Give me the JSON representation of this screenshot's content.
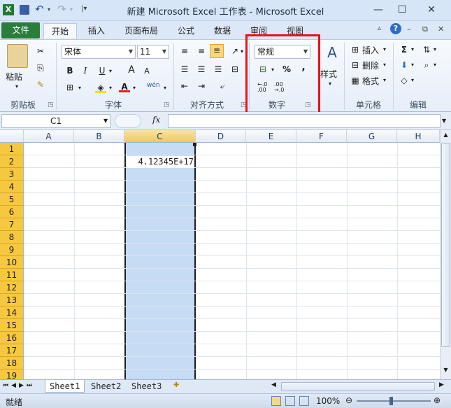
{
  "window": {
    "title": "新建 Microsoft Excel 工作表 - Microsoft Excel",
    "quick_access": [
      "save-icon",
      "undo-icon",
      "redo-icon",
      "customize-icon"
    ]
  },
  "tabs": [
    "文件",
    "开始",
    "插入",
    "页面布局",
    "公式",
    "数据",
    "审阅",
    "视图"
  ],
  "active_tab": "开始",
  "ribbon": {
    "clipboard": {
      "paste_label": "粘贴",
      "group_label": "剪贴板"
    },
    "font": {
      "font_name": "宋体",
      "font_size": "11",
      "group_label": "字体",
      "bold": "B",
      "italic": "I",
      "underline": "U",
      "grow": "A",
      "shrink": "A",
      "wen": "wén"
    },
    "alignment": {
      "group_label": "对齐方式"
    },
    "number": {
      "format": "常规",
      "percent": "%",
      "comma": ",",
      "group_label": "数字",
      "inc_decimal": "+.0 .00",
      "dec_decimal": ".00 ->.0"
    },
    "styles": {
      "label": "样式"
    },
    "cells": {
      "insert": "插入",
      "delete": "删除",
      "format": "格式",
      "group_label": "单元格"
    },
    "editing": {
      "group_label": "编辑",
      "sigma": "Σ"
    }
  },
  "formula_bar": {
    "name_box": "C1",
    "fx": "fx",
    "value": ""
  },
  "grid": {
    "columns": [
      "A",
      "B",
      "C",
      "D",
      "E",
      "F",
      "G",
      "H"
    ],
    "rows": [
      "1",
      "2",
      "3",
      "4",
      "5",
      "6",
      "7",
      "8",
      "9",
      "10",
      "11",
      "12",
      "13",
      "14",
      "15",
      "16",
      "17",
      "18",
      "19"
    ],
    "selected_column": "C",
    "cells": {
      "C2": "4.12345E+17"
    }
  },
  "sheets": [
    "Sheet1",
    "Sheet2",
    "Sheet3"
  ],
  "active_sheet": "Sheet1",
  "status": {
    "mode": "就绪",
    "zoom": "100%"
  },
  "colors": {
    "file_tab": "#2a7d3a",
    "row_header": "#f6c83f",
    "selection": "#c5dcf4",
    "highlight": "#e8131b"
  }
}
